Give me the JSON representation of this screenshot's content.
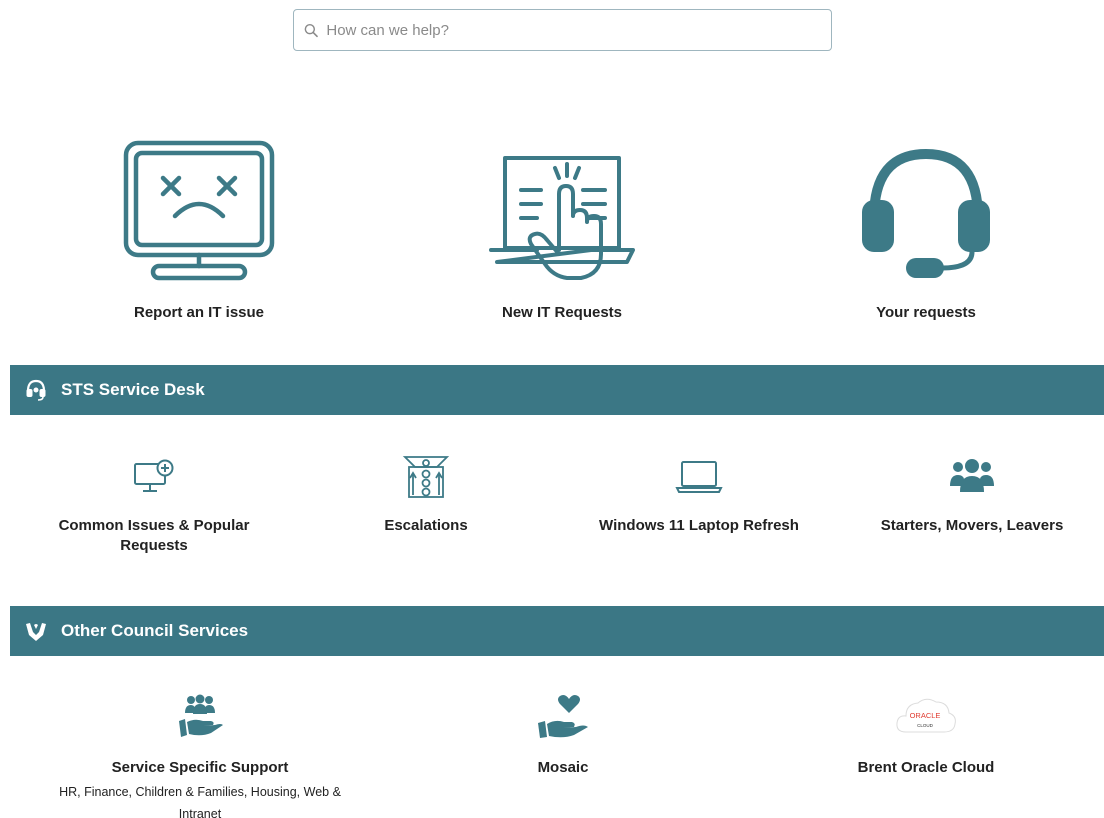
{
  "search": {
    "placeholder": "How can we help?"
  },
  "hero": [
    {
      "label": "Report an IT issue",
      "icon": "sad-monitor-icon"
    },
    {
      "label": "New IT Requests",
      "icon": "hand-tap-laptop-icon"
    },
    {
      "label": "Your requests",
      "icon": "headset-icon"
    }
  ],
  "sections": [
    {
      "title": "STS Service Desk",
      "icon": "headset-icon",
      "tiles": [
        {
          "label": "Common Issues & Popular Requests",
          "icon": "monitor-add-icon"
        },
        {
          "label": "Escalations",
          "icon": "escalation-icon"
        },
        {
          "label": "Windows 11 Laptop Refresh",
          "icon": "laptop-icon"
        },
        {
          "label": "Starters, Movers, Leavers",
          "icon": "users-group-icon"
        }
      ]
    },
    {
      "title": "Other Council Services",
      "icon": "hands-support-icon",
      "tiles": [
        {
          "label": "Service Specific Support",
          "sub": "HR, Finance, Children & Families, Housing, Web & Intranet",
          "icon": "hand-people-icon"
        },
        {
          "label": "Mosaic",
          "icon": "hand-heart-icon"
        },
        {
          "label": "Brent Oracle Cloud",
          "icon": "oracle-cloud-icon",
          "logo_text": "ORACLE CLOUD"
        }
      ]
    }
  ],
  "colors": {
    "teal": "#3b7785",
    "icon_teal": "#3d7a87",
    "oracle_red": "#e03c31"
  }
}
